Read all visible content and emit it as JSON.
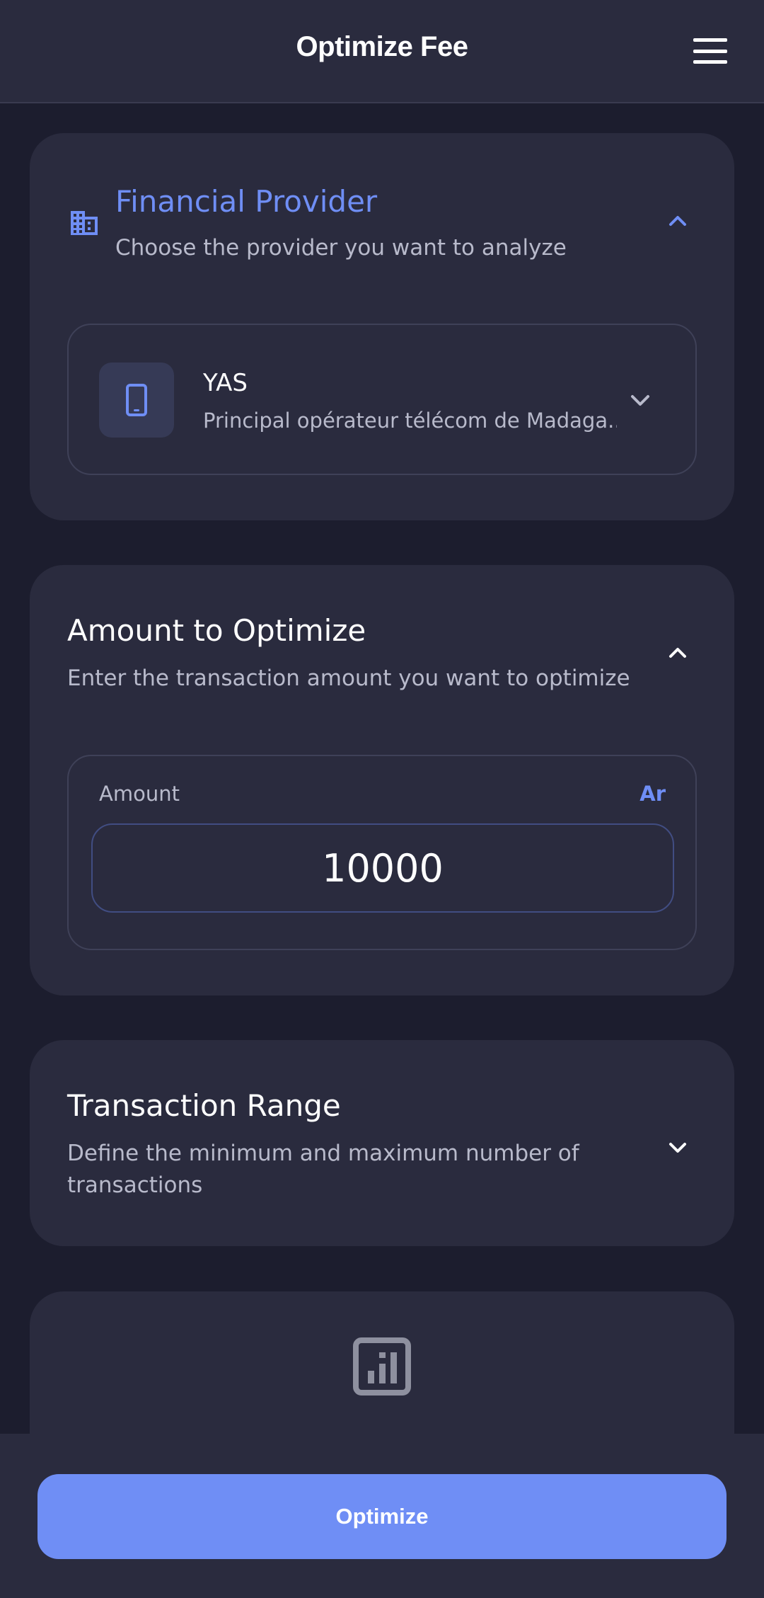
{
  "header": {
    "title": "Optimize Fee",
    "menu_icon": "hamburger-menu-icon"
  },
  "provider_section": {
    "title": "Financial Provider",
    "subtitle": "Choose the provider you want to analyze",
    "icon": "building-icon",
    "expanded": true,
    "selected": {
      "name": "YAS",
      "description": "Principal opérateur télécom de Madaga...",
      "icon": "smartphone-icon"
    }
  },
  "amount_section": {
    "title": "Amount to Optimize",
    "subtitle": "Enter the transaction amount you want to optimize",
    "expanded": true,
    "field_label": "Amount",
    "currency": "Ar",
    "value": "10000"
  },
  "range_section": {
    "title": "Transaction Range",
    "subtitle": "Define the minimum and maximum number of transactions",
    "expanded": false
  },
  "results_section": {
    "icon": "bar-chart-icon"
  },
  "footer": {
    "optimize_label": "Optimize"
  },
  "colors": {
    "background": "#1c1d2e",
    "card": "#2a2b3e",
    "accent": "#6f8ef5",
    "muted_text": "#b8bacb"
  }
}
